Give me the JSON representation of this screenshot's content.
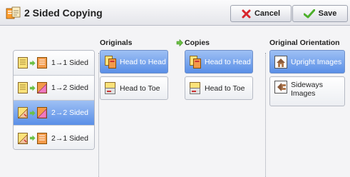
{
  "header": {
    "title": "2 Sided Copying",
    "cancel_label": "Cancel",
    "save_label": "Save"
  },
  "presets": [
    {
      "label": "1→1 Sided",
      "selected": false
    },
    {
      "label": "1→2 Sided",
      "selected": false
    },
    {
      "label": "2→2 Sided",
      "selected": true
    },
    {
      "label": "2→1 Sided",
      "selected": false
    }
  ],
  "originals": {
    "heading": "Originals",
    "options": [
      {
        "label": "Head to Head",
        "selected": true
      },
      {
        "label": "Head to Toe",
        "selected": false
      }
    ]
  },
  "copies": {
    "heading": "Copies",
    "options": [
      {
        "label": "Head to Head",
        "selected": true
      },
      {
        "label": "Head to Toe",
        "selected": false
      }
    ]
  },
  "orientation": {
    "heading": "Original Orientation",
    "options": [
      {
        "label": "Upright Images",
        "selected": true
      },
      {
        "label": "Sideways Images",
        "selected": false
      }
    ]
  },
  "colors": {
    "selected": "#5a8fe7",
    "accent_green": "#4caf2a",
    "cancel_red": "#d8262c"
  }
}
